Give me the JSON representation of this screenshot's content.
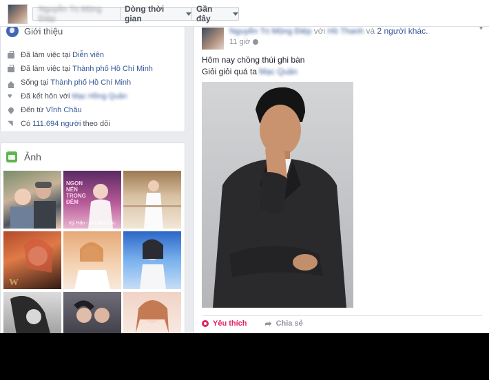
{
  "topbar": {
    "profile_name": "Nguyễn Trị Mộng Điệp",
    "timeline_label": "Dòng thời gian",
    "recent_label": "Gần đây"
  },
  "intro": {
    "title": "Giới thiệu",
    "items": [
      {
        "icon": "briefcase-icon",
        "prefix": "Đã làm việc tại",
        "value": "Diễn viên",
        "blurred": false
      },
      {
        "icon": "briefcase-icon",
        "prefix": "Đã làm việc tại",
        "value": "Thành phố Hồ Chí Minh",
        "blurred": false
      },
      {
        "icon": "house-icon",
        "prefix": "Sống tại",
        "value": "Thành phố Hồ Chí Minh",
        "blurred": false
      },
      {
        "icon": "heart-icon",
        "prefix": "Đã kết hôn với",
        "value": "Mạc Hồng Quân",
        "blurred": true
      },
      {
        "icon": "location-pin-icon",
        "prefix": "Đến từ",
        "value": "Vĩnh Châu",
        "blurred": false
      },
      {
        "icon": "rss-icon",
        "prefix": "Có",
        "value": "111.694 người",
        "suffix": "theo dõi",
        "blurred": false
      }
    ]
  },
  "photos": {
    "title": "Ảnh",
    "captions": {
      "p2_title": "NGỌN NẾN TRONG ĐÊM",
      "p2_sub": "Kỳ Hân - Vai Mai Trúc"
    }
  },
  "post": {
    "author": "Nguyễn Trị Mộng Điệp",
    "with_text": "với",
    "with_name": "Hồ Thanh",
    "and_text": "và",
    "others": "2 người khác.",
    "time": "11 giờ",
    "line1": "Hôm nay chồng thúi ghi bàn",
    "line2": "Giỏi giỏi quá ta",
    "line2_tag": "Mạc Quân",
    "like_label": "Yêu thích",
    "share_label": "Chia sẻ"
  },
  "colors": {
    "link": "#365899",
    "like": "#e0245e",
    "background": "#e9ebee"
  }
}
